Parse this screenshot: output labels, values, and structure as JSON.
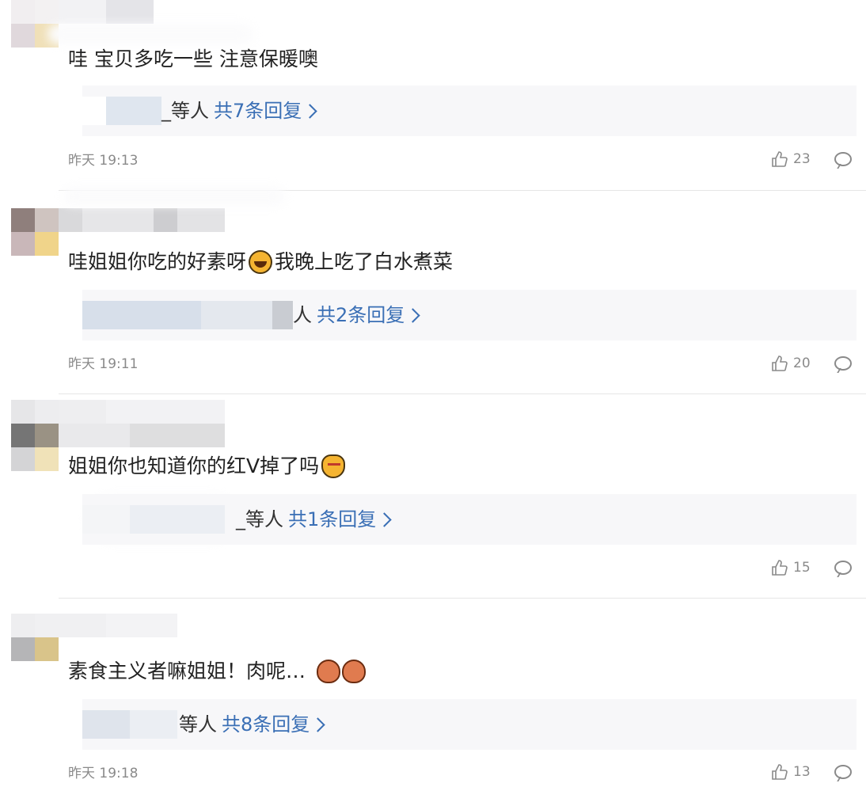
{
  "comments": [
    {
      "content": "哇 宝贝多吃一些 注意保暖噢",
      "reply_prefix": "_等人",
      "reply_link": "共7条回复",
      "time": "昨天 19:13",
      "likes": "23"
    },
    {
      "content_a": "哇姐姐你吃的好素呀",
      "content_b": "我晚上吃了白水煮菜",
      "reply_prefix": "人",
      "reply_link": "共2条回复",
      "time": "昨天 19:11",
      "likes": "20"
    },
    {
      "content": "姐姐你也知道你的红V掉了吗",
      "reply_prefix": "_等人",
      "reply_link": "共1条回复",
      "time": "",
      "likes": "15"
    },
    {
      "content": "素食主义者嘛姐姐！肉呢…",
      "reply_prefix": "等人",
      "reply_link": "共8条回复",
      "time": "昨天 19:18",
      "likes": "13"
    }
  ],
  "colors": {
    "link": "#3a6fb5",
    "meta": "#8a8a8a",
    "reply_bg": "#f7f7f9"
  },
  "icons": {
    "like": "thumbs-up-icon",
    "comment": "comment-bubble-icon",
    "laugh_emoji": "laughing-tears-emoji",
    "cat_emoji": "cat-emoji",
    "heart_emoji": "bear-heart-emoji"
  }
}
